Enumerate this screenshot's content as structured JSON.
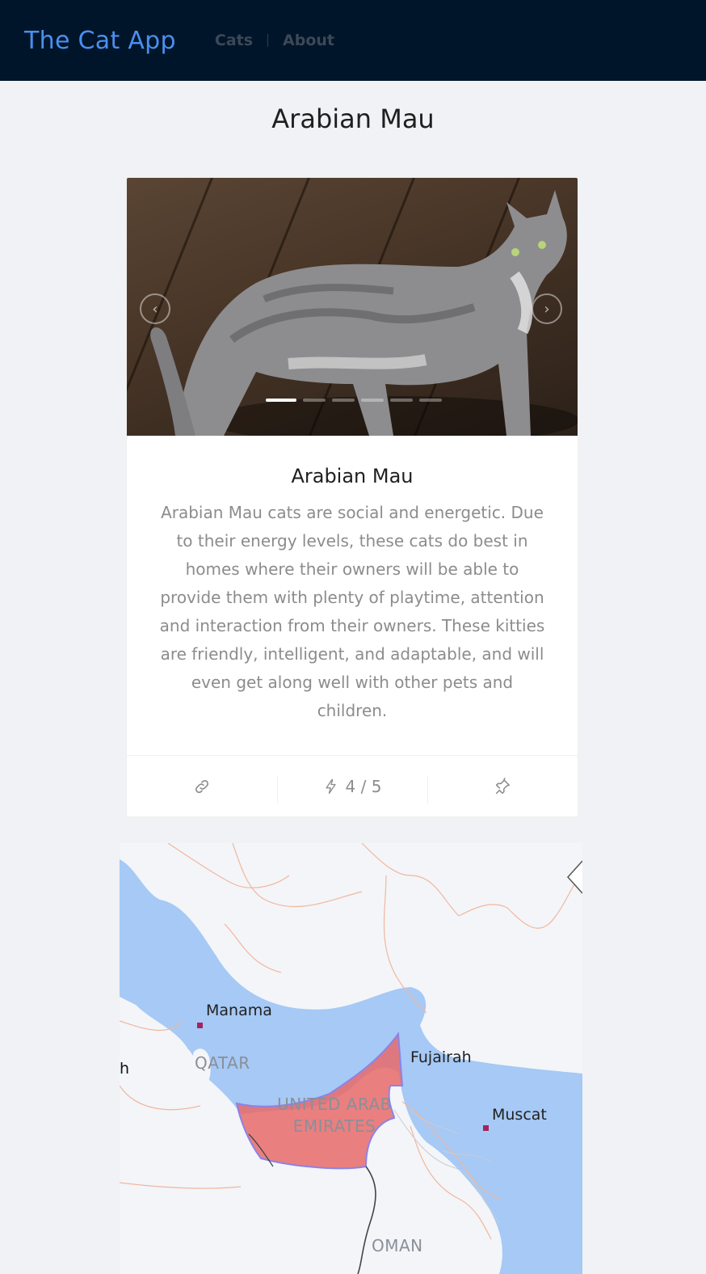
{
  "header": {
    "logo": "The Cat App",
    "nav": [
      {
        "label": "Cats"
      },
      {
        "label": "About"
      }
    ]
  },
  "page": {
    "title": "Arabian Mau"
  },
  "card": {
    "title": "Arabian Mau",
    "description": "Arabian Mau cats are social and energetic. Due to their energy levels, these cats do best in homes where their owners will be able to provide them with plenty of playtime, attention and interaction from their owners. These kitties are friendly, intelligent, and adaptable, and will even get along well with other pets and children.",
    "carousel": {
      "slide_count": 6,
      "active_index": 0
    },
    "actions": {
      "link_icon": "link-icon",
      "energy_icon": "lightning-icon",
      "energy_value": "4 / 5",
      "pin_icon": "pin-icon"
    }
  },
  "map": {
    "cities": [
      "Manama",
      "Fujairah",
      "Muscat"
    ],
    "countries": {
      "qatar": "QATAR",
      "uae_line1": "UNITED ARAB",
      "uae_line2": "EMIRATES",
      "oman": "OMAN",
      "left_partial": "h"
    },
    "highlight_color": "#e86a6a",
    "water_color": "#a6c9f5"
  }
}
